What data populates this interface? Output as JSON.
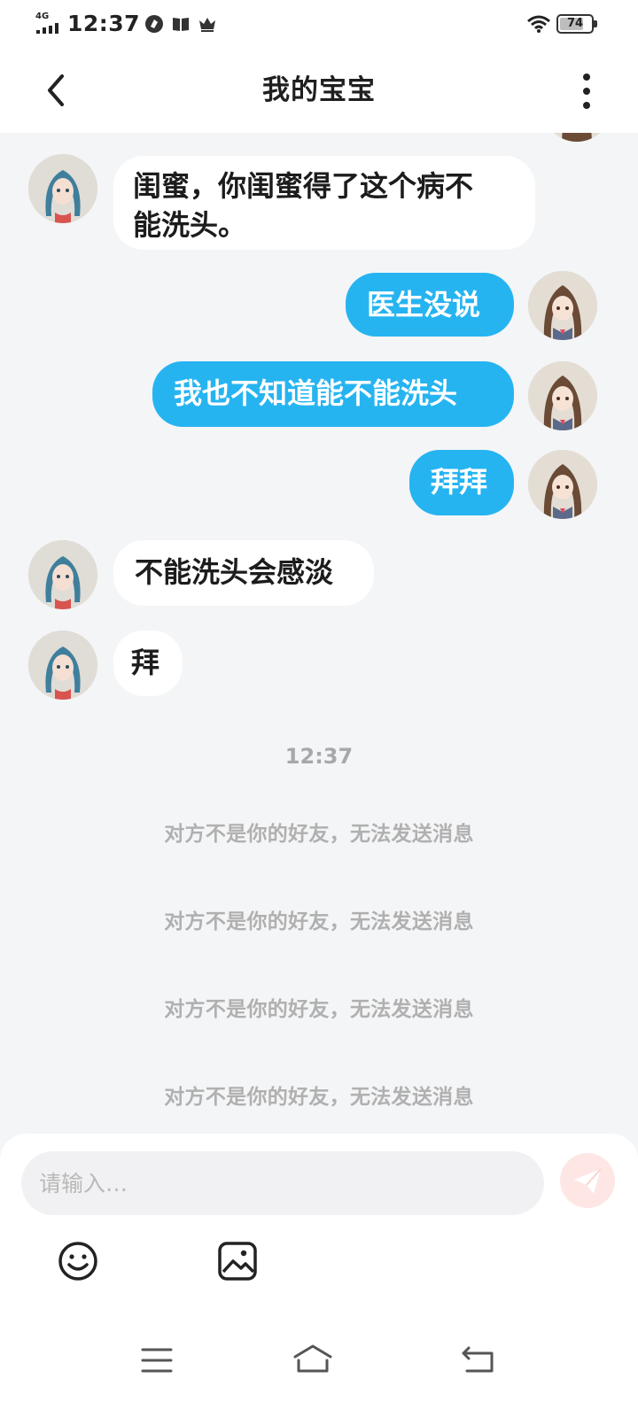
{
  "status_bar": {
    "network": "4G",
    "time": "12:37",
    "battery_level": "74",
    "icons": [
      "nfc-icon",
      "book-icon",
      "crown-icon",
      "wifi-icon",
      "battery-icon"
    ]
  },
  "header": {
    "title": "我的宝宝"
  },
  "messages": [
    {
      "side": "in",
      "text_line1": "闺蜜，你闺蜜得了这个病不",
      "text_line2": "能洗头。"
    },
    {
      "side": "out",
      "text": "医生没说"
    },
    {
      "side": "out",
      "text": "我也不知道能不能洗头"
    },
    {
      "side": "out",
      "text": "拜拜"
    },
    {
      "side": "in",
      "text": "不能洗头会感淡"
    },
    {
      "side": "in",
      "text": "拜"
    }
  ],
  "time_separator": "12:37",
  "notices": [
    "对方不是你的好友，无法发送消息",
    "对方不是你的好友，无法发送消息",
    "对方不是你的好友，无法发送消息",
    "对方不是你的好友，无法发送消息"
  ],
  "input": {
    "placeholder": "请输入…",
    "value": ""
  },
  "colors": {
    "outgoing_bubble": "#26b4f1",
    "incoming_bubble": "#ffffff",
    "chat_background": "#f4f5f7",
    "send_button": "#f6a29a"
  }
}
